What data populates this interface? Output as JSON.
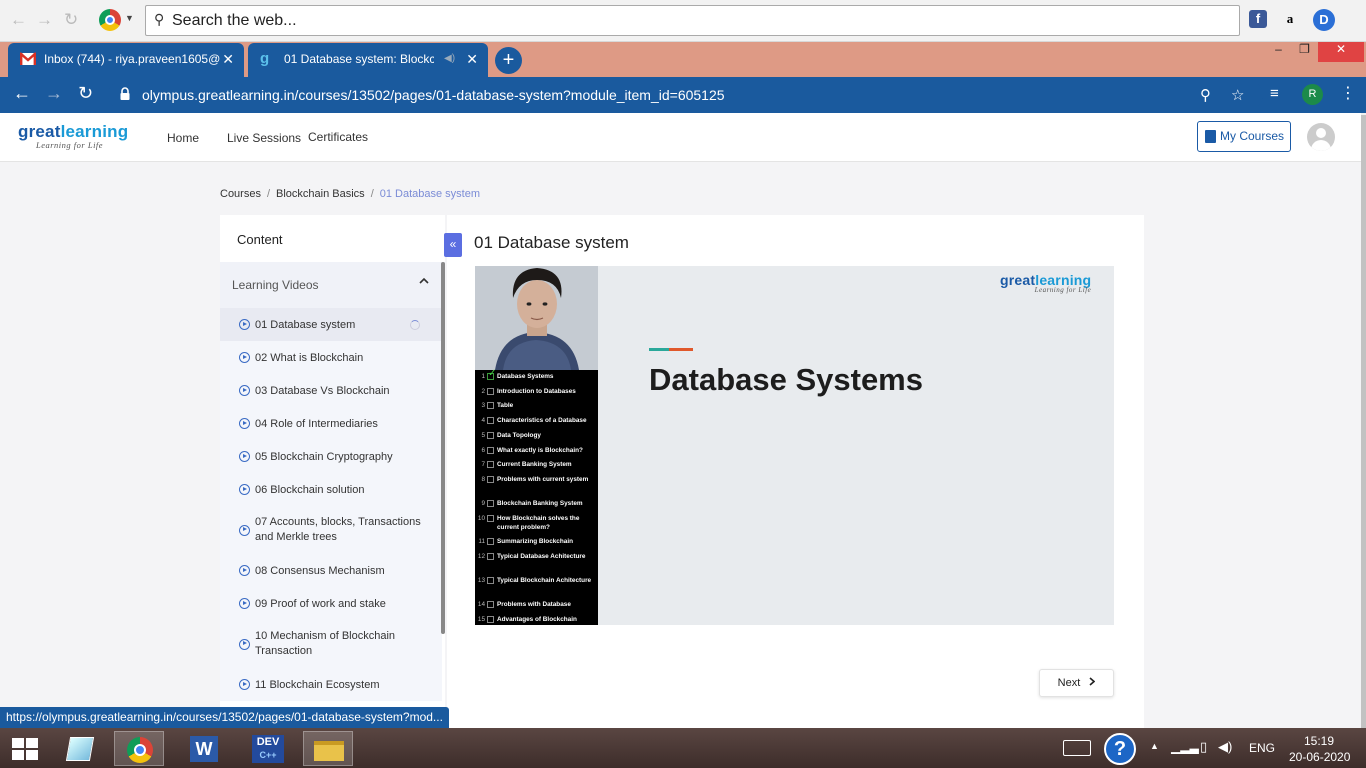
{
  "browser": {
    "search_placeholder": "Search the web...",
    "tabs": [
      {
        "title": "Inbox (744) - riya.praveen1605@",
        "close": "✕"
      },
      {
        "title": "01 Database system: Blockch",
        "close": "✕"
      }
    ],
    "new_tab": "+",
    "url": "olympus.greatlearning.in/courses/13502/pages/01-database-system?module_item_id=605125",
    "profile_initial": "R",
    "window_buttons": {
      "minimize": "–",
      "maximize": "❐",
      "close": "✕"
    },
    "status_url": "https://olympus.greatlearning.in/courses/13502/pages/01-database-system?mod..."
  },
  "site": {
    "logo_main_a": "great",
    "logo_main_b": "learning",
    "logo_sub": "Learning for Life",
    "nav": [
      "Home",
      "Live Sessions",
      "Certificates"
    ],
    "my_courses": "My Courses"
  },
  "breadcrumb": {
    "items": [
      "Courses",
      "Blockchain Basics",
      "01 Database system"
    ],
    "separator": "/"
  },
  "sidebar": {
    "title": "Content",
    "collapse_symbol": "«",
    "section": "Learning Videos",
    "section_chevron": "^",
    "lessons": [
      "01 Database system",
      "02 What is Blockchain",
      "03 Database Vs Blockchain",
      "04 Role of Intermediaries",
      "05 Blockchain Cryptography",
      "06 Blockchain solution",
      "07 Accounts, blocks, Transactions and Merkle trees",
      "08 Consensus Mechanism",
      "09 Proof of work and stake",
      "10 Mechanism of Blockchain Transaction",
      "11 Blockchain Ecosystem"
    ]
  },
  "main": {
    "title": "01 Database system",
    "video": {
      "heading": "Database Systems",
      "logo_a": "great",
      "logo_b": "learning",
      "logo_sub": "Learning for Life",
      "toc": [
        {
          "n": "1",
          "t": "Database Systems",
          "done": true
        },
        {
          "n": "2",
          "t": "Introduction to Databases"
        },
        {
          "n": "3",
          "t": "Table"
        },
        {
          "n": "4",
          "t": "Characteristics of a Database"
        },
        {
          "n": "5",
          "t": "Data Topology"
        },
        {
          "n": "6",
          "t": "What exactly is Blockchain?"
        },
        {
          "n": "7",
          "t": "Current Banking System"
        },
        {
          "n": "8",
          "t": "Problems with current system"
        },
        {
          "n": "9",
          "t": "Blockchain Banking System"
        },
        {
          "n": "10",
          "t": "How Blockchain solves the current problem?"
        },
        {
          "n": "11",
          "t": "Summarizing Blockchain"
        },
        {
          "n": "12",
          "t": "Typical Database Achitecture"
        },
        {
          "n": "13",
          "t": "Typical Blockchain Achitecture"
        },
        {
          "n": "14",
          "t": "Problems with Database"
        },
        {
          "n": "15",
          "t": "Advantages of Blockchain"
        }
      ]
    },
    "next_label": "Next"
  },
  "taskbar": {
    "apps": [
      "Start",
      "Notes",
      "Chrome",
      "Word",
      "DEV C++",
      "File Explorer"
    ],
    "dev_label": "DEV",
    "dev_sub": "C++",
    "word_letter": "W",
    "help": "?",
    "lang": "ENG",
    "time": "15:19",
    "date": "20-06-2020"
  }
}
